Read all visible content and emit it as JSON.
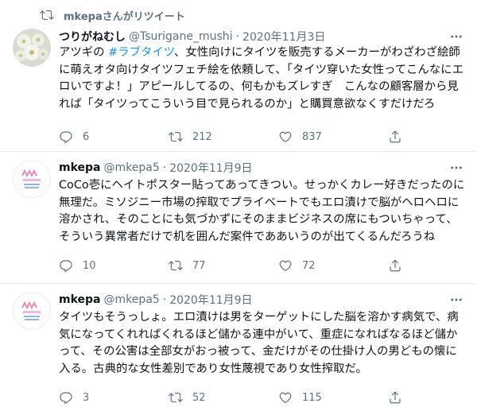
{
  "retweet_header": {
    "text": "mkepaさんがリツイート"
  },
  "tweets": [
    {
      "name": "つりがねむし",
      "handle": "@Tsurigane_mushi",
      "date": "2020年11月3日",
      "text_before": "アツギの ",
      "hashtag": "#ラブタイツ",
      "text_after": "、女性向けにタイツを販売するメーカーがわざわざ絵師に萌えオタ向けタイツフェチ絵を依頼して、「タイツ穿いた女性ってこんなにエロいですよ！」アピールしてるの、何もかもズレすぎ　こんなの顧客層から見れば「タイツってこういう目で見られるのか」と購買意欲なくすだけだろ",
      "replies": "6",
      "retweets": "212",
      "likes": "837"
    },
    {
      "name": "mkepa",
      "handle": "@mkepa5",
      "date": "2020年11月9日",
      "text": "CoCo壱にヘイトポスター貼ってあってきつい。せっかくカレー好きだったのに無理だ。ミソジニー市場の搾取でプライベートでもエロ漬けで脳がヘロヘロに溶かされ、そのことにも気づかずにそのままビジネスの席にもついちゃって、そういう異常者だけで机を囲んだ案件でああいうのが出てくるんだろうね",
      "replies": "10",
      "retweets": "77",
      "likes": "72"
    },
    {
      "name": "mkepa",
      "handle": "@mkepa5",
      "date": "2020年11月9日",
      "text": "タイツもそうっしょ。エロ漬けは男をターゲットにした脳を溶かす病気で、病気になってくれればくれるほど儲かる連中がいて、重症になればなるほど儲かって、その公害は全部女がおっ被って、金だけがその仕掛け人の男どもの懐に入る。古典的な女性差別であり女性蔑視であり女性搾取だ。",
      "replies": "3",
      "retweets": "52",
      "likes": "115"
    }
  ],
  "icons": {
    "retweet_indicator": "retweet-icon",
    "reply": "reply-icon",
    "retweet": "retweet-icon",
    "like": "heart-icon",
    "share": "share-icon",
    "more": "more-icon"
  },
  "colors": {
    "secondary_text": "#5b7083",
    "hashtag": "#1b95e0",
    "divider": "#e6ecf0"
  }
}
